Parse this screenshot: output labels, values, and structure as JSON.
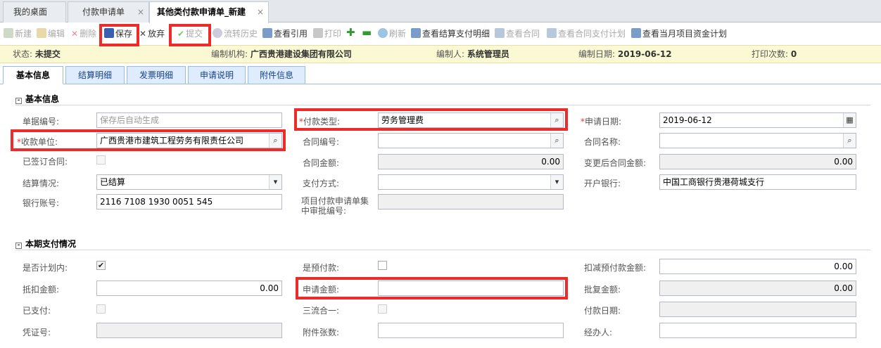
{
  "window_tabs": [
    {
      "label": "我的桌面"
    },
    {
      "label": "付款申请单",
      "close": "×"
    },
    {
      "label": "其他类付款申请单_新建",
      "close": "×"
    }
  ],
  "toolbar": {
    "new": "新建",
    "edit": "编辑",
    "delete": "删除",
    "save": "保存",
    "discard": "放弃",
    "submit": "提交",
    "flow_history": "流转历史",
    "view_ref": "查看引用",
    "print": "打印",
    "refresh": "刷新",
    "view_settle_detail": "查看结算支付明细",
    "view_contract": "查看合同",
    "view_contract_plan": "查看合同支付计划",
    "view_month_plan": "查看当月项目资金计划"
  },
  "status": {
    "state_label": "状态:",
    "state_value": "未提交",
    "org_label": "编制机构:",
    "org_value": "广西贵港建设集团有限公司",
    "author_label": "编制人:",
    "author_value": "系统管理员",
    "date_label": "编制日期:",
    "date_value": "2019-06-12",
    "print_label": "打印次数:",
    "print_value": "0"
  },
  "sub_tabs": [
    "基本信息",
    "结算明细",
    "发票明细",
    "申请说明",
    "附件信息"
  ],
  "section1": {
    "title": "基本信息",
    "doc_no_label": "单据编号:",
    "doc_no_placeholder": "保存后自动生成",
    "pay_type_label": "付款类型:",
    "pay_type_value": "劳务管理费",
    "apply_date_label": "申请日期:",
    "apply_date_value": "2019-06-12",
    "payee_label": "收款单位:",
    "payee_value": "广西贵港市建筑工程劳务有限责任公司",
    "contract_no_label": "合同编号:",
    "contract_no_value": "",
    "contract_name_label": "合同名称:",
    "contract_name_value": "",
    "signed_label": "已签订合同:",
    "contract_amount_label": "合同金额:",
    "contract_amount_value": "0.00",
    "changed_amount_label": "变更后合同金额:",
    "changed_amount_value": "0.00",
    "settle_label": "结算情况:",
    "settle_value": "已结算",
    "pay_method_label": "支付方式:",
    "pay_method_value": "",
    "bank_label": "开户银行:",
    "bank_value": "中国工商银行贵港荷城支行",
    "account_label": "银行账号:",
    "account_value": "2116 7108 1930 0051 545",
    "batch_no_label": "项目付款申请单集中审批编号:",
    "batch_no_value": ""
  },
  "section2": {
    "title": "本期支付情况",
    "in_plan_label": "是否计划内:",
    "in_plan_checked": true,
    "prepay_label": "是预付款:",
    "deduct_prepay_label": "扣减预付款金额:",
    "deduct_prepay_value": "0.00",
    "offset_label": "抵扣金额:",
    "offset_value": "0.00",
    "apply_amount_label": "申请金额:",
    "apply_amount_value": "",
    "approved_label": "批复金额:",
    "approved_value": "0.00",
    "paid_label": "已支付:",
    "three_flow_label": "三流合一:",
    "pay_date_label": "付款日期:",
    "pay_date_value": "",
    "voucher_label": "凭证号:",
    "voucher_value": "",
    "attach_count_label": "附件张数:",
    "attach_count_value": "",
    "handler_label": "经办人:",
    "handler_value": ""
  },
  "icons": {
    "search": "magnifier-icon",
    "dropdown": "chevron-down-icon",
    "calendar": "calendar-icon",
    "check": "✔",
    "required": "*"
  },
  "colors": {
    "highlight": "#ee2b2b",
    "status_bg": "#fbf8d4",
    "tab_border": "#99bbe8"
  }
}
